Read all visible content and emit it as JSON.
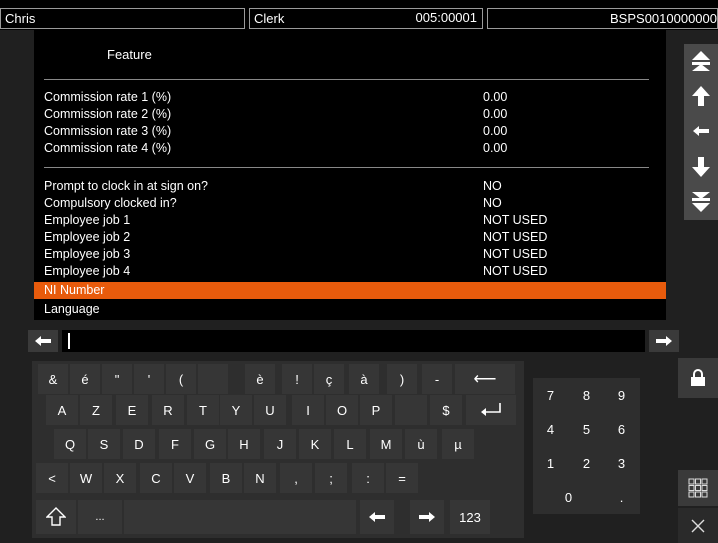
{
  "header": {
    "user": "Chris",
    "role": "Clerk",
    "terminal": "005:00001",
    "device": "BSPS0010000000"
  },
  "panel": {
    "title": "Feature",
    "commission_rows": [
      {
        "label": "Commission rate 1 (%)",
        "value": "0.00"
      },
      {
        "label": "Commission rate 2 (%)",
        "value": "0.00"
      },
      {
        "label": "Commission rate 3 (%)",
        "value": "0.00"
      },
      {
        "label": "Commission rate 4 (%)",
        "value": "0.00"
      }
    ],
    "employee_rows": [
      {
        "label": "Prompt to clock in at sign on?",
        "value": "NO"
      },
      {
        "label": "Compulsory clocked in?",
        "value": "NO"
      },
      {
        "label": "Employee job 1",
        "value": "NOT USED"
      },
      {
        "label": "Employee job 2",
        "value": "NOT USED"
      },
      {
        "label": "Employee job 3",
        "value": "NOT USED"
      },
      {
        "label": "Employee job 4",
        "value": "NOT USED"
      }
    ],
    "selected_row": {
      "label": "NI Number"
    },
    "last_row": {
      "label": "Language"
    }
  },
  "input": {
    "value": ""
  },
  "keyboard": {
    "row1": [
      "&",
      "é",
      "\"",
      "'",
      "(",
      "",
      "è",
      "!",
      "ç",
      "à",
      ")",
      "-",
      "⟵"
    ],
    "row2": [
      "A",
      "Z",
      "E",
      "R",
      "T",
      "Y",
      "U",
      "I",
      "O",
      "P",
      "",
      "$"
    ],
    "row3": [
      "Q",
      "S",
      "D",
      "F",
      "G",
      "H",
      "J",
      "K",
      "L",
      "M",
      "ù",
      "µ"
    ],
    "row4": [
      "<",
      "W",
      "X",
      "C",
      "V",
      "B",
      "N",
      ",",
      ";",
      ":",
      "="
    ],
    "row5": {
      "symbols": "...",
      "mode": "123"
    }
  },
  "numpad": {
    "keys": [
      "7",
      "8",
      "9",
      "4",
      "5",
      "6",
      "1",
      "2",
      "3",
      "0",
      "."
    ]
  },
  "icons": {
    "scroll_top": "double-chevron-up-icon",
    "scroll_up": "arrow-up-icon",
    "back": "arrow-left-icon",
    "scroll_down": "arrow-down-icon",
    "scroll_bottom": "double-chevron-down-icon",
    "lock": "lock-icon",
    "grid": "grid-icon",
    "close": "close-icon"
  },
  "colors": {
    "selected": "#e85b0c",
    "panel": "#000000",
    "background": "#202020"
  }
}
